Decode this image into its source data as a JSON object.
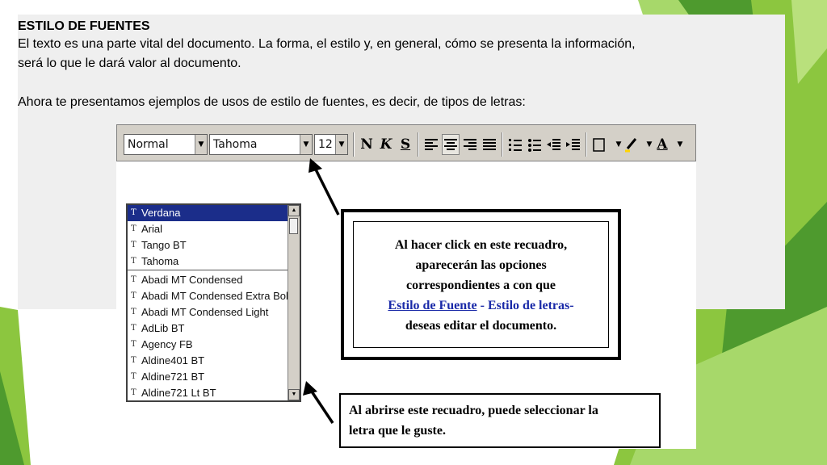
{
  "slide": {
    "title": "ESTILO DE FUENTES",
    "para1_line1": "El texto es una parte vital del documento. La forma, el estilo y, en general, cómo se presenta la información,",
    "para1_line2": "será lo que le dará valor al documento.",
    "para2": "Ahora te presentamos ejemplos de usos de estilo de fuentes, es decir, de tipos de letras:"
  },
  "toolbar": {
    "style_value": "Normal",
    "font_value": "Tahoma",
    "size_value": "12",
    "bold_label": "N",
    "italic_label": "K",
    "underline_label": "S",
    "font_color_label": "A"
  },
  "font_list": {
    "selected": "Verdana",
    "recent": [
      "Arial",
      "Tango BT",
      "Tahoma"
    ],
    "all": [
      "Abadi MT Condensed",
      "Abadi MT Condensed Extra Bold",
      "Abadi MT Condensed Light",
      "AdLib BT",
      "Agency FB",
      "Aldine401 BT",
      "Aldine721 BT",
      "Aldine721 Lt BT"
    ]
  },
  "callout_box": {
    "line1": "Al hacer click en este recuadro,",
    "line2": "aparecerán las opciones",
    "line3": "correspondientes a con que",
    "link_text": "Estilo de Fuente",
    "link_rest": " - Estilo de letras-",
    "line5": "deseas editar el documento."
  },
  "callout_list": {
    "line1": "Al abrirse este recuadro, puede seleccionar la",
    "line2": "letra que le guste."
  },
  "colors": {
    "accent_green": "#8cc63f",
    "dark_green": "#4a8a2a",
    "selection_blue": "#1b2d8a",
    "link_blue": "#1a2aa8"
  }
}
